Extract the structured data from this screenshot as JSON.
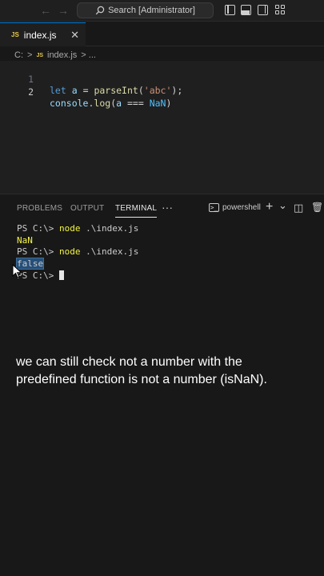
{
  "titlebar": {
    "search_label": "Search [Administrator]",
    "back_glyph": "←",
    "forward_glyph": "→",
    "icons": [
      "toggle-primary-sidebar-icon",
      "toggle-panel-icon",
      "toggle-secondary-sidebar-icon",
      "customize-layout-icon"
    ]
  },
  "tab": {
    "badge": "JS",
    "label": "index.js",
    "close_glyph": "✕"
  },
  "breadcrumb": {
    "drive": "C:",
    "sep": ">",
    "badge": "JS",
    "file": "index.js",
    "more": "> ..."
  },
  "editor": {
    "lines": [
      {
        "number": "1",
        "tokens": [
          [
            "kw",
            "let"
          ],
          [
            "op",
            " "
          ],
          [
            "var",
            "a"
          ],
          [
            "op",
            " = "
          ],
          [
            "fn",
            "parseInt"
          ],
          [
            "op",
            "("
          ],
          [
            "str",
            "'abc'"
          ],
          [
            "op",
            ");"
          ]
        ]
      },
      {
        "number": "2",
        "tokens": [
          [
            "var",
            "console"
          ],
          [
            "op",
            "."
          ],
          [
            "fn",
            "log"
          ],
          [
            "op",
            "("
          ],
          [
            "var",
            "a"
          ],
          [
            "op",
            " === "
          ],
          [
            "nan",
            "NaN"
          ],
          [
            "op",
            ")"
          ]
        ]
      }
    ]
  },
  "panel": {
    "tabs": [
      "PROBLEMS",
      "OUTPUT",
      "TERMINAL"
    ],
    "active_tab": "TERMINAL",
    "more_glyph": "···",
    "terminal_name": "powershell",
    "terminal_glyph": ">_",
    "add_glyph": "+",
    "dropdown_glyph": "⌄",
    "split_glyph": "◫",
    "trash_glyph": "🗑"
  },
  "terminal": {
    "prompt": "PS C:\\>",
    "command": "node",
    "argument": ".\\index.js",
    "output_1": "NaN",
    "output_2": "false"
  },
  "caption": "we can still check not a number with the predefined function is not a number (isNaN).",
  "colors": {
    "accent": "#0078d4",
    "keyword": "#569cd6",
    "function": "#dcdcaa",
    "string": "#ce9178",
    "terminal_yellow": "#f5f543",
    "selection": "#264f78"
  }
}
